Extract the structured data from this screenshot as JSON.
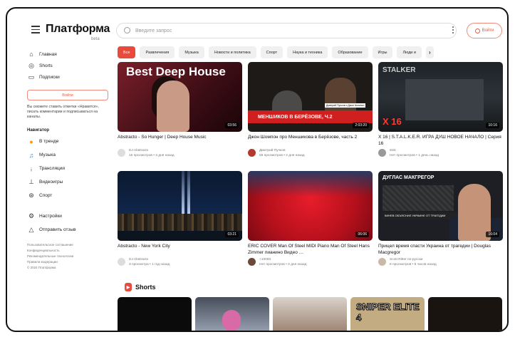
{
  "app": {
    "logo": "Платформа",
    "logo_sub": "beta"
  },
  "header": {
    "search_placeholder": "Введите запрос",
    "login_label": "Войти"
  },
  "sidebar": {
    "main_items": [
      {
        "label": "Главная",
        "icon": "home-icon"
      },
      {
        "label": "Shorts",
        "icon": "shorts-icon"
      },
      {
        "label": "Подписки",
        "icon": "subscriptions-icon"
      }
    ],
    "login_label": "Войти",
    "hint": "Вы сможете ставить отметки «Нравится», писать комментарии и подписываться на каналы.",
    "section_title": "Навигатор",
    "nav_items": [
      {
        "label": "В тренде",
        "icon": "fire-icon"
      },
      {
        "label": "Музыка",
        "icon": "music-icon"
      },
      {
        "label": "Трансляции",
        "icon": "live-icon"
      },
      {
        "label": "Видеоигры",
        "icon": "gamepad-icon"
      },
      {
        "label": "Спорт",
        "icon": "trophy-icon"
      }
    ],
    "bottom_items": [
      {
        "label": "Настройки",
        "icon": "settings-icon"
      },
      {
        "label": "Отправить отзыв",
        "icon": "feedback-icon"
      }
    ],
    "footer_links": [
      "Пользовательское соглашение",
      "Конфиденциальность",
      "Рекомендательные технологии",
      "Правила модерации",
      "© 2024 Платформа"
    ]
  },
  "chips": [
    "Все",
    "Развлечения",
    "Музыка",
    "Новости и политика",
    "Спорт",
    "Наука и техника",
    "Образование",
    "Игры",
    "Люди и"
  ],
  "chip_next": "›",
  "videos": [
    {
      "title": "Abstracto - So Hunger | Deep House Music",
      "channel": "DJ Abstracto",
      "stats": "15 просмотров • 4 дня назад",
      "duration": "03:56",
      "thumb_text": "Best Deep House"
    },
    {
      "title": "Джон Шомпон про Меншикова в Берёзове, часть 2",
      "channel": "Дмитрий Пучков",
      "stats": "55 просмотров • 2 дня назад",
      "duration": "2:03:20",
      "thumb_text": "МЕНШИКОВ В БЕРЁЗОВЕ, Ч.2",
      "thumb_tag": "Дмитрий Пучков и Джон Шомпон"
    },
    {
      "title": "X 16 | S.T.A.L.K.E.R. ИГРА ДУШ НОВОЕ НАЧАЛО | Серия 16",
      "channel": "stnk",
      "stats": "Нет просмотров • 1 день назад",
      "duration": "10:16",
      "thumb_text": "X 16",
      "thumb_game": "STALKER"
    },
    {
      "title": "Abstracto - New York City",
      "channel": "DJ Abstracto",
      "stats": "3 просмотра • 1 год назад",
      "duration": "03:21"
    },
    {
      "title": "ERIC COVER Man Of Steel MIDI Piano Man Of Steel Hans Zimmer пианино Видео …",
      "channel": "+10000",
      "stats": "Нет просмотров • 2 дня назад",
      "duration": "06:06"
    },
    {
      "title": "Прицел время спасти Украина от трагедии | Douglas Macgregor",
      "channel": "Scott Ritter по-русски",
      "stats": "8 просмотров • 5 часов назад",
      "duration": "16:04",
      "thumb_text": "ДУГЛАС МАКГРЕГОР",
      "thumb_strip": "КИНЕВ ОБЪЯСНИЛ УКРАИНЕ ОТ ТРАГЕДИИ"
    }
  ],
  "shorts": {
    "title": "Shorts",
    "items": [
      {
        "thumb_text": ""
      },
      {
        "thumb_text": ""
      },
      {
        "thumb_text": ""
      },
      {
        "thumb_text": "SNIPER ELITE 4"
      },
      {
        "thumb_text": ""
      }
    ]
  }
}
